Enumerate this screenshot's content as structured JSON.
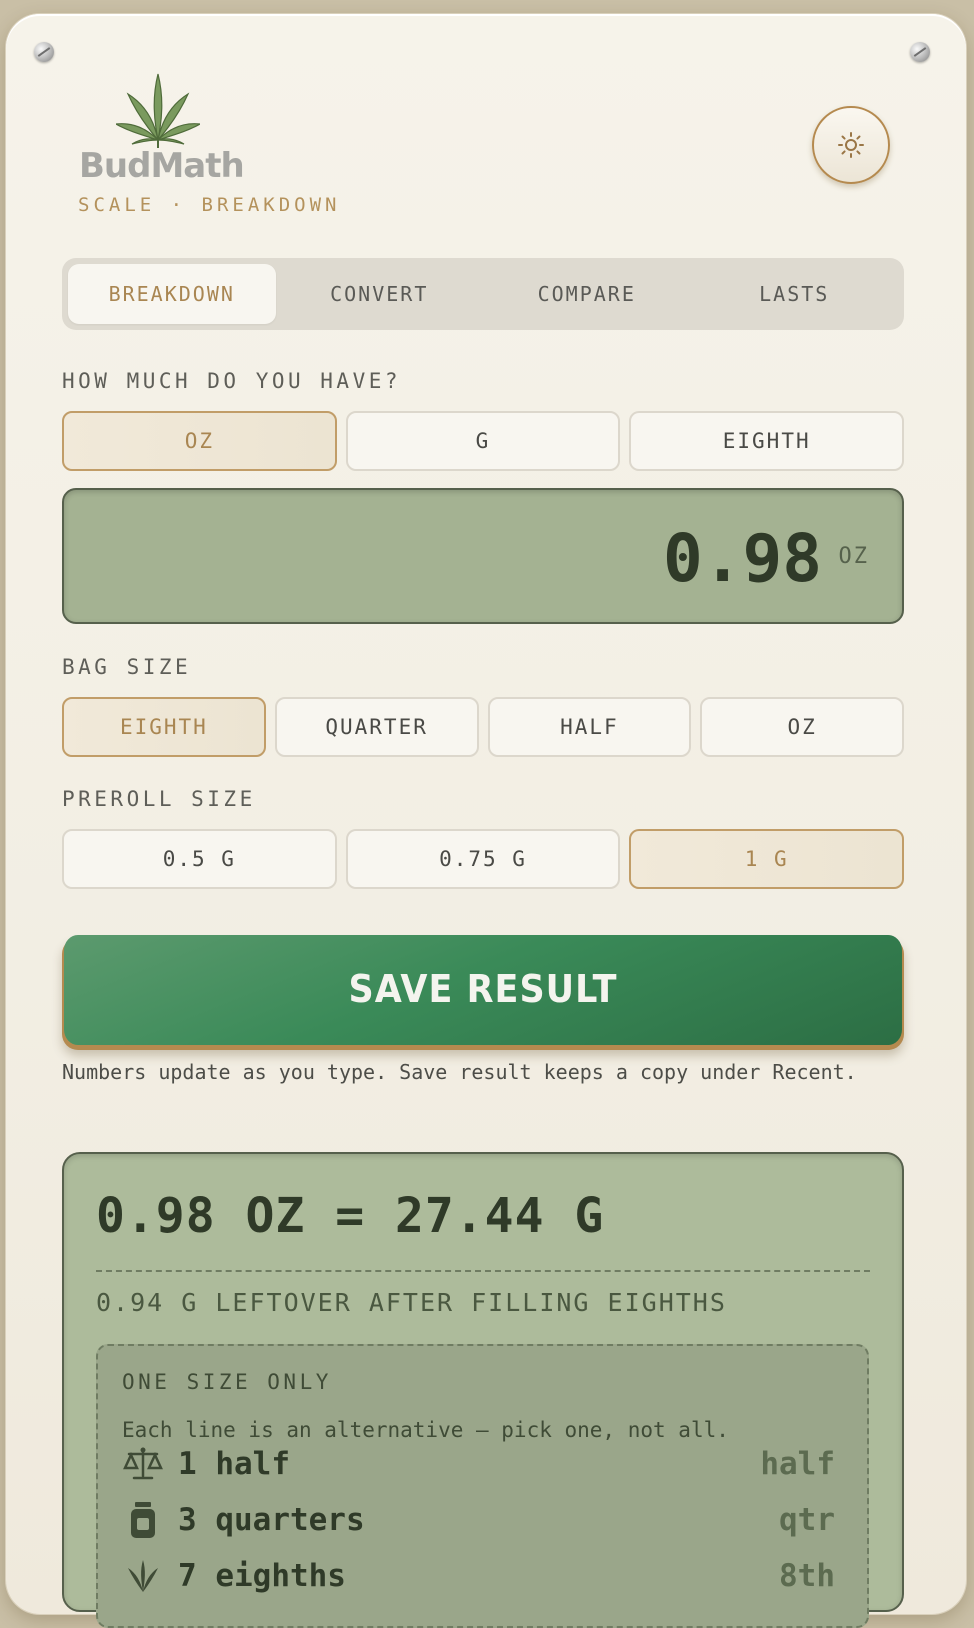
{
  "app": {
    "name": "BudMath",
    "tagline": "SCALE · BREAKDOWN",
    "theme_icon": "sun-icon",
    "colors": {
      "accent": "#b58a4f",
      "lcd": "#a4b292",
      "save": "#3a8a58"
    }
  },
  "tabs": [
    {
      "label": "BREAKDOWN",
      "active": true
    },
    {
      "label": "CONVERT",
      "active": false
    },
    {
      "label": "COMPARE",
      "active": false
    },
    {
      "label": "LASTS",
      "active": false
    }
  ],
  "amount": {
    "label": "HOW MUCH DO YOU HAVE?",
    "units": [
      {
        "label": "OZ",
        "selected": true
      },
      {
        "label": "G",
        "selected": false
      },
      {
        "label": "EIGHTH",
        "selected": false
      }
    ],
    "value": "0.98",
    "unit": "OZ"
  },
  "bag_size": {
    "label": "BAG SIZE",
    "options": [
      {
        "label": "EIGHTH",
        "selected": true
      },
      {
        "label": "QUARTER",
        "selected": false
      },
      {
        "label": "HALF",
        "selected": false
      },
      {
        "label": "OZ",
        "selected": false
      }
    ]
  },
  "preroll_size": {
    "label": "PREROLL SIZE",
    "options": [
      {
        "label": "0.5 G",
        "selected": false
      },
      {
        "label": "0.75 G",
        "selected": false
      },
      {
        "label": "1 G",
        "selected": true
      }
    ]
  },
  "save_label": "SAVE RESULT",
  "hint": "Numbers update as you type. Save result keeps a copy under Recent.",
  "result": {
    "headline": "0.98 OZ = 27.44 G",
    "leftover": "0.94 G LEFTOVER AFTER FILLING EIGHTHS",
    "one_size": {
      "title": "ONE SIZE ONLY",
      "note": "Each line is an alternative — pick one, not all.",
      "lines": [
        {
          "icon": "scale-icon",
          "text": "1 half",
          "abbr": "half"
        },
        {
          "icon": "jar-icon",
          "text": "3 quarters",
          "abbr": "qtr"
        },
        {
          "icon": "leaf-icon",
          "text": "7 eighths",
          "abbr": "8th"
        }
      ]
    }
  }
}
